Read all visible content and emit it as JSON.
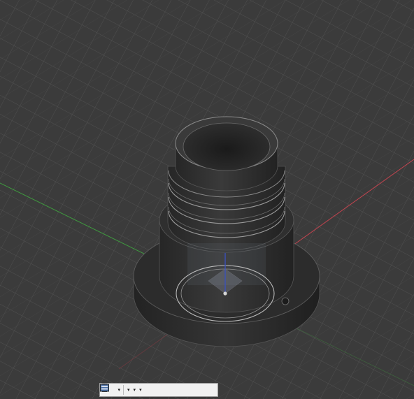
{
  "app": {
    "view_mode": "perspective",
    "background_color": "#3b3b3b"
  },
  "viewport": {
    "grid": "on",
    "axes": {
      "x_color": "#c0444f",
      "y_color": "#3f9a3f",
      "z_color": "#3b54c8"
    },
    "model": {
      "type": "threaded-cylindrical-fitting",
      "color": "#2b2b2b"
    }
  },
  "navbar": {
    "tools": [
      {
        "icon": "pan-orbit-icon",
        "has_dropdown": true
      },
      {
        "icon": "look-at-icon",
        "has_dropdown": false
      },
      {
        "icon": "pan-hand-icon",
        "has_dropdown": false
      },
      {
        "icon": "zoom-window-icon",
        "has_dropdown": false
      },
      {
        "icon": "fit-zoom-icon",
        "has_dropdown": true
      },
      {
        "icon": "display-settings-icon",
        "has_dropdown": true
      },
      {
        "icon": "grid-snap-icon",
        "has_dropdown": true
      },
      {
        "icon": "viewports-icon",
        "has_dropdown": true
      }
    ]
  }
}
